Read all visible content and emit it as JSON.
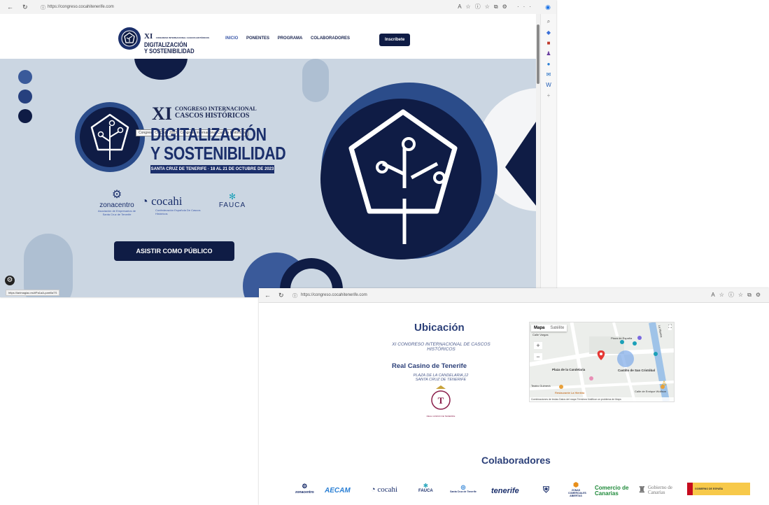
{
  "window1": {
    "url": "https://congreso.cocahitenerife.com",
    "logo_small": {
      "line1": "XI",
      "line2": "CONGRESO INTERNACIONAL CASCOS HISTÓRICOS",
      "line3": "DIGITALIZACIÓN",
      "line4": "Y SOSTENIBILIDAD"
    },
    "menu": [
      "INICIO",
      "PONENTES",
      "PROGRAMA",
      "COLABORADORES"
    ],
    "cta": "Inscríbete",
    "tooltip": "Congreso COCAHI 2023 - Congreso Internacional Cascos Históricos",
    "hero": {
      "xi": "XI",
      "congreso_l1": "CONGRESO INTERNACIONAL",
      "congreso_l2": "CASCOS HISTÓRICOS",
      "title_l1": "DIGITALIZACIÓN",
      "title_l2": "Y SOSTENIBILIDAD",
      "dates": "SANTA CRUZ DE TENERIFE · 18 AL 21 DE OCTUBRE DE 2023",
      "button": "ASISTIR COMO PÚBLICO"
    },
    "org_logos": {
      "zonacentro": "zonacentro",
      "zonacentro_sub": "Asociación de Empresarios de Santa Cruz de Tenerife",
      "cocahi": "cocahi",
      "cocahi_sub": "Confederación Española De Cascos Históricos",
      "fauca": "FAUCA"
    },
    "status": "https://larimagiac.es/#Pa1aA-parrillaTS"
  },
  "window2": {
    "url": "https://congreso.cocahitenerife.com",
    "ubicacion": "Ubicación",
    "congreso": "XI CONGRESO INTERNACIONAL DE CASCOS HISTÓRICOS",
    "venue": "Real Casino de Tenerife",
    "address_l1": "PLAZA DE LA CANDELARIA,12",
    "address_l2": "SANTA CRUZ DE TENERIFE",
    "seal_text": "REAL CASINO DE TENERIFE",
    "map": {
      "tab_map": "Mapa",
      "tab_satellite": "Satélite",
      "labels": [
        "Plaza de España",
        "Plaza de la Candelaria",
        "Castillo de San Cristóbal",
        "Restaurante La Hierbita",
        "Teatro Guimerá",
        "Calle Vargas",
        "La Marina",
        "Calle de Enrique Wolfson"
      ],
      "footer": "Combinaciones de teclas   Datos del mapa   Términos   Notificar un problema de Maps"
    },
    "colaboradores": "Colaboradores",
    "sponsors": [
      "zonacentro",
      "AECAM",
      "cocahi",
      "FAUCA",
      "Santa Cruz de Tenerife",
      "tenerife",
      "ZONAS COMERCIALES ABIERTAS",
      "Comercio de Canarias",
      "Gobierno de Canarias",
      "GOBIERNO DE ESPAÑA"
    ]
  }
}
